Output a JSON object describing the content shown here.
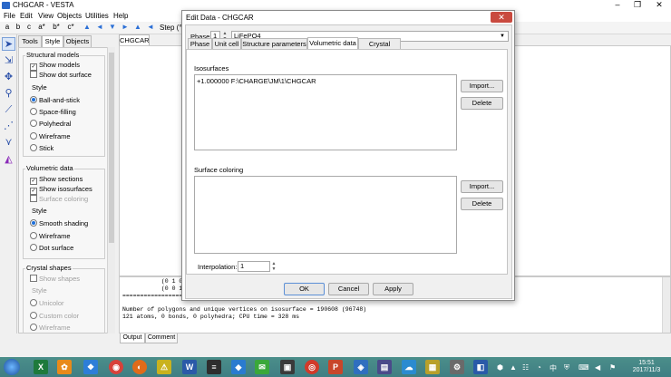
{
  "window": {
    "title": "CHGCAR - VESTA",
    "minimize": "–",
    "maximize": "❐",
    "close": "✕"
  },
  "menu": [
    "File",
    "Edit",
    "View",
    "Objects",
    "Utilities",
    "Help"
  ],
  "toolbar": {
    "buttons": [
      "a",
      "b",
      "c",
      "a*",
      "b*",
      "c*"
    ],
    "arrows": [
      "▲",
      "◄",
      "▼",
      "►",
      "▲",
      "◄",
      "▼",
      "►"
    ],
    "step_label": "Step (°)"
  },
  "panel": {
    "tabs": [
      "Tools",
      "Style",
      "Objects"
    ],
    "structural_models": {
      "title": "Structural models",
      "show_models": "Show models",
      "show_dot_surface": "Show dot surface",
      "style_label": "Style",
      "styles": [
        "Ball-and-stick",
        "Space-filling",
        "Polyhedral",
        "Wireframe",
        "Stick"
      ],
      "selected_style": "Ball-and-stick"
    },
    "volumetric_data": {
      "title": "Volumetric data",
      "show_sections": "Show sections",
      "show_isosurfaces": "Show isosurfaces",
      "surface_coloring": "Surface coloring",
      "style_label": "Style",
      "styles": [
        "Smooth shading",
        "Wireframe",
        "Dot surface"
      ],
      "selected_style": "Smooth shading"
    },
    "crystal_shapes": {
      "title": "Crystal shapes",
      "show_shapes": "Show shapes",
      "style_label": "Style",
      "styles": [
        "Unicolor",
        "Custom color",
        "Wireframe"
      ]
    }
  },
  "view": {
    "tab": "CHGCAR",
    "output_lines": [
      "           (0 1 0):",
      "           (0 0 1):",
      "========================================================================",
      "",
      "Number of polygons and unique vertices on isosurface = 190608 (96748)",
      "121 atoms, 0 bonds, 0 polyhedra; CPU time = 328 ms"
    ],
    "output_tabs": [
      "Output",
      "Comment"
    ]
  },
  "dialog": {
    "title": "Edit Data - CHGCAR",
    "close": "✕",
    "phase_label": "Phase:",
    "phase_value": "1",
    "phase_name": "LiFePO4",
    "tabs": [
      "Phase",
      "Unit cell",
      "Structure parameters",
      "Volumetric data",
      "Crystal shape"
    ],
    "active_tab": "Volumetric data",
    "isosurfaces_label": "Isosurfaces",
    "isosurface_entry": "+1.000000 F:\\CHARGE\\JM\\1\\CHGCAR",
    "surface_coloring_label": "Surface coloring",
    "import_label": "Import...",
    "delete_label": "Delete",
    "interpolation_label": "Interpolation:",
    "interpolation_value": "1",
    "ok_label": "OK",
    "cancel_label": "Cancel",
    "apply_label": "Apply"
  },
  "taskbar": {
    "time": "15:51",
    "date": "2017/11/3",
    "apps": [
      "excel",
      "app2",
      "app3",
      "app4",
      "chrome",
      "firefox",
      "app7",
      "word",
      "app9",
      "wechat",
      "app11",
      "app12",
      "powerpoint",
      "app14",
      "app15",
      "app16",
      "app17",
      "app18",
      "app19"
    ]
  },
  "colors": {
    "taskbar": "#3f7e83",
    "accent": "#1e6fd9",
    "close": "#c94a3f"
  }
}
